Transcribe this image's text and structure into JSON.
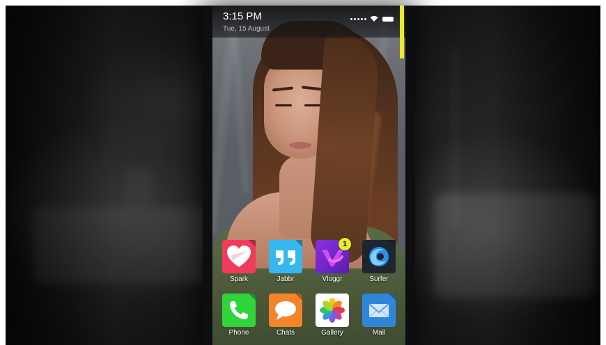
{
  "status_bar": {
    "time": "3:15 PM",
    "date": "Tue, 15 August"
  },
  "icons": {
    "signal": "signal-dots-icon",
    "wifi": "wifi-icon",
    "battery": "battery-icon"
  },
  "colors": {
    "accent": "#e7ec2a"
  },
  "apps": [
    {
      "label": "Spark",
      "icon": "heart-icon",
      "color": "#f23a5b"
    },
    {
      "label": "Jabbr",
      "icon": "quote-icon",
      "color": "#35b7f0"
    },
    {
      "label": "Vloggr",
      "icon": "v-logo-icon",
      "color": "#7a2bd6",
      "badge": "1"
    },
    {
      "label": "Surfer",
      "icon": "browser-swirl-icon",
      "color": "#1f2530"
    },
    {
      "label": "Phone",
      "icon": "phone-icon",
      "color": "#2fd53a"
    },
    {
      "label": "Chats",
      "icon": "speech-bubble-icon",
      "color": "#f4842a"
    },
    {
      "label": "Gallery",
      "icon": "pinwheel-icon",
      "color": "#ffffff"
    },
    {
      "label": "Mail",
      "icon": "envelope-icon",
      "color": "#2f86d8"
    }
  ]
}
